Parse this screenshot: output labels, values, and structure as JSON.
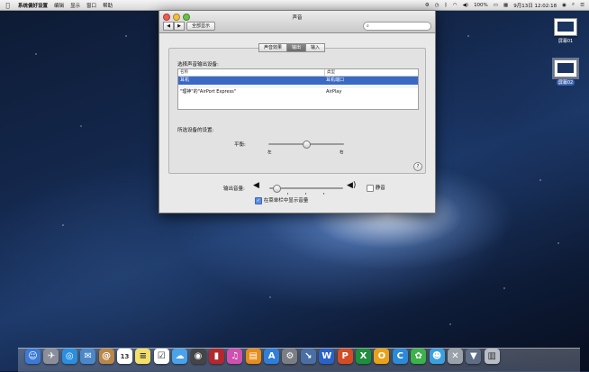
{
  "menubar": {
    "apple": "",
    "app_name": "系统偏好设置",
    "menus": [
      "编辑",
      "显示",
      "窗口",
      "帮助"
    ],
    "right": {
      "battery": "100%",
      "date_time": "9月13日 12:02:18"
    }
  },
  "desktop": {
    "icons": [
      {
        "label": "屏幕01"
      },
      {
        "label": "屏幕02"
      }
    ]
  },
  "window": {
    "title": "声音",
    "show_all": "全部显示",
    "search_placeholder": "",
    "tabs": [
      "声音效果",
      "输出",
      "输入"
    ],
    "active_tab": "输出",
    "section_label": "选择声音输出设备:",
    "table": {
      "headers": [
        "名称",
        "类型"
      ],
      "rows": [
        {
          "name": "耳机",
          "type": "耳机端口"
        },
        {
          "name": "\"理神\"的\"AirPort Express\"",
          "type": "AirPlay"
        }
      ]
    },
    "device_settings_label": "所选设备的设置:",
    "balance": {
      "label": "平衡:",
      "left": "左",
      "right": "右",
      "value": 0.5
    },
    "output_volume": {
      "label": "输出音量:",
      "value": 0.05,
      "mute_label": "静音",
      "muted": false
    },
    "show_in_menubar": {
      "label": "在菜单栏中显示音量",
      "checked": true
    },
    "help": "?"
  },
  "dock": {
    "items": [
      {
        "icon": "finder-icon",
        "color": "#3d7ad6",
        "glyph": "☺"
      },
      {
        "icon": "launchpad-icon",
        "color": "#8a8f9a",
        "glyph": "✈"
      },
      {
        "icon": "safari-icon",
        "color": "#2b8fe0",
        "glyph": "◎"
      },
      {
        "icon": "mail-icon",
        "color": "#4b88c9",
        "glyph": "✉"
      },
      {
        "icon": "contacts-icon",
        "color": "#b8874a",
        "glyph": "@"
      },
      {
        "icon": "calendar-icon",
        "color": "#ffffff",
        "glyph": "13"
      },
      {
        "icon": "notes-icon",
        "color": "#f3df6a",
        "glyph": "≡"
      },
      {
        "icon": "reminders-icon",
        "color": "#ffffff",
        "glyph": "☑"
      },
      {
        "icon": "messages-icon",
        "color": "#4aa2e8",
        "glyph": "☁"
      },
      {
        "icon": "facetime-icon",
        "color": "#454545",
        "glyph": "◉"
      },
      {
        "icon": "photo-booth-icon",
        "color": "#b3282e",
        "glyph": "▮"
      },
      {
        "icon": "itunes-icon",
        "color": "#d04fb0",
        "glyph": "♫"
      },
      {
        "icon": "ibooks-icon",
        "color": "#e58c1a",
        "glyph": "▤"
      },
      {
        "icon": "app-store-icon",
        "color": "#2f7fd8",
        "glyph": "A"
      },
      {
        "icon": "system-preferences-icon",
        "color": "#7b7e85",
        "glyph": "⚙"
      },
      {
        "icon": "launcher-icon",
        "color": "#4a6fa5",
        "glyph": "↘"
      },
      {
        "icon": "word-icon",
        "color": "#2a63c7",
        "glyph": "W"
      },
      {
        "icon": "powerpoint-icon",
        "color": "#d34c26",
        "glyph": "P"
      },
      {
        "icon": "excel-icon",
        "color": "#1e8f3c",
        "glyph": "X"
      },
      {
        "icon": "outlook-icon",
        "color": "#e8a21a",
        "glyph": "O"
      },
      {
        "icon": "lync-icon",
        "color": "#2c8ad6",
        "glyph": "C"
      },
      {
        "icon": "messenger-icon",
        "color": "#3cb24a",
        "glyph": "✿"
      },
      {
        "icon": "qq-icon",
        "color": "#3aa0e0",
        "glyph": "☻"
      },
      {
        "icon": "crossover-icon",
        "color": "#9aa1a9",
        "glyph": "✕"
      },
      {
        "icon": "downloads-icon",
        "color": "#5f6e86",
        "glyph": "▼"
      },
      {
        "icon": "trash-icon",
        "color": "#b9bec6",
        "glyph": "▥"
      }
    ]
  }
}
